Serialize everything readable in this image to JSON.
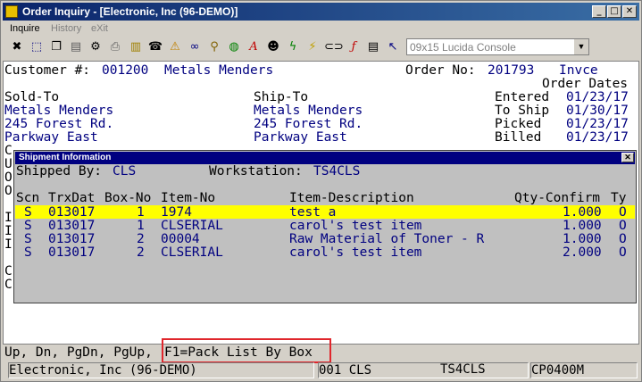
{
  "window": {
    "title": "Order Inquiry - [Electronic, Inc (96-DEMO)]",
    "buttons": [
      "_",
      "□",
      "✕"
    ]
  },
  "menu": [
    {
      "label": "Inquire",
      "enabled": true
    },
    {
      "label": "History",
      "enabled": false
    },
    {
      "label": "eXit",
      "enabled": false
    }
  ],
  "toolbar": {
    "icons": [
      "close-icon",
      "select-icon",
      "copy-icon",
      "print-preview-icon",
      "settings-icon",
      "print-icon",
      "note-icon",
      "contact-icon",
      "alert-icon",
      "binoculars-icon",
      "search-icon",
      "globe-icon",
      "font-icon",
      "person-icon",
      "lightning-icon",
      "lightning-alt-icon",
      "link-icon",
      "function-icon",
      "document-icon",
      "help-pointer-icon"
    ],
    "font_select": "09x15 Lucida Console"
  },
  "header": {
    "customer_label": "Customer #:",
    "customer_no": "001200",
    "customer_name": "Metals Menders",
    "order_label": "Order No:",
    "order_no": "201793",
    "status": "Invce",
    "order_dates_label": "Order Dates"
  },
  "sold_to": {
    "label": "Sold-To",
    "lines": [
      "Metals Menders",
      "245 Forest Rd.",
      "Parkway East"
    ]
  },
  "ship_to": {
    "label": "Ship-To",
    "lines": [
      "Metals Menders",
      "245 Forest Rd.",
      "Parkway East"
    ]
  },
  "dates": [
    {
      "label": "Entered",
      "value": "01/23/17"
    },
    {
      "label": "To Ship",
      "value": "01/30/17"
    },
    {
      "label": "Picked",
      "value": "01/23/17"
    },
    {
      "label": "Billed",
      "value": "01/23/17"
    }
  ],
  "left_fragments": [
    "C",
    "U",
    "O",
    "O",
    "",
    "I",
    "I",
    "I",
    "",
    "C",
    "C"
  ],
  "shipment": {
    "title": "Shipment Information",
    "close": "✕",
    "shipped_by_label": "Shipped By:",
    "shipped_by": "CLS",
    "workstation_label": "Workstation:",
    "workstation": "TS4CLS",
    "columns": [
      "Scn",
      "TrxDat",
      "Box-No",
      "Item-No",
      "Item-Description",
      "Qty-Confirm",
      "Ty"
    ],
    "rows": [
      {
        "scn": "S",
        "trxdat": "013017",
        "box": "1",
        "item": "1974",
        "desc": "test a",
        "qty": "1.000",
        "ty": "O"
      },
      {
        "scn": "S",
        "trxdat": "013017",
        "box": "1",
        "item": "CLSERIAL",
        "desc": "carol's test item",
        "qty": "1.000",
        "ty": "O"
      },
      {
        "scn": "S",
        "trxdat": "013017",
        "box": "2",
        "item": "00004",
        "desc": "Raw Material of Toner - R",
        "qty": "1.000",
        "ty": "O"
      },
      {
        "scn": "S",
        "trxdat": "013017",
        "box": "2",
        "item": "CLSERIAL",
        "desc": "carol's test item",
        "qty": "2.000",
        "ty": "O"
      }
    ],
    "highlight_color": "#ffff00"
  },
  "keys": {
    "nav": "Up, Dn, PgDn, PgUp,",
    "f1": "F1=Pack List By Box"
  },
  "status": [
    "Electronic, Inc (96-DEMO)",
    "001 CLS",
    "TS4CLS",
    "CP0400M"
  ]
}
